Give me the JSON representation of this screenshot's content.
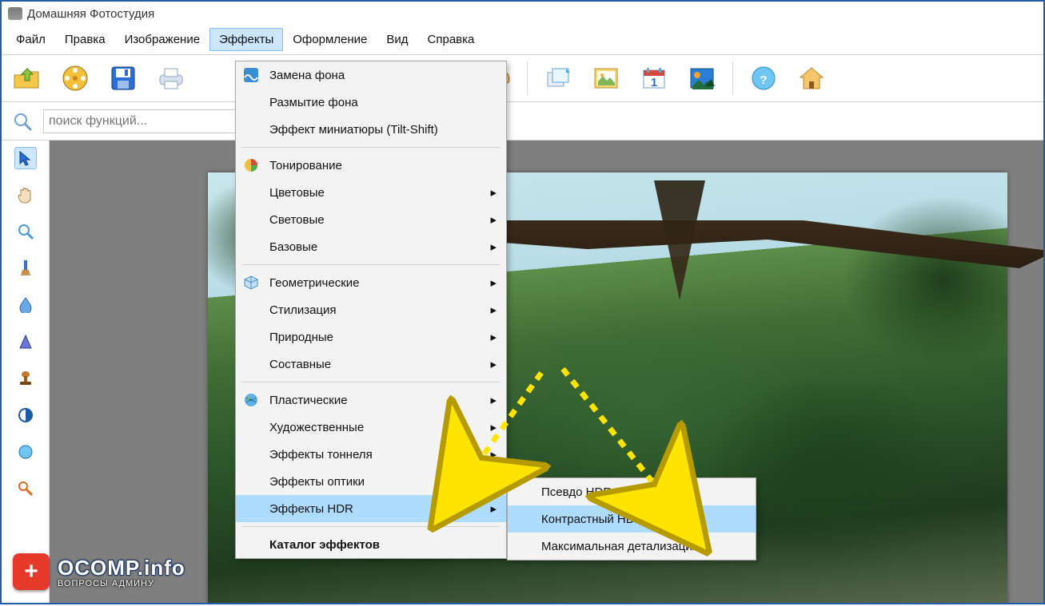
{
  "window": {
    "title": "Домашняя Фотостудия"
  },
  "menubar": {
    "items": [
      {
        "label": "Файл"
      },
      {
        "label": "Правка"
      },
      {
        "label": "Изображение"
      },
      {
        "label": "Эффекты",
        "active": true
      },
      {
        "label": "Оформление"
      },
      {
        "label": "Вид"
      },
      {
        "label": "Справка"
      }
    ]
  },
  "toolbar": {
    "buttons": [
      {
        "name": "open-folder-button",
        "icon": "folder-open"
      },
      {
        "name": "gallery-button",
        "icon": "reel"
      },
      {
        "name": "save-button",
        "icon": "floppy"
      },
      {
        "name": "print-button",
        "icon": "printer"
      },
      {
        "sep": true,
        "after_dropdown": true
      },
      {
        "name": "palette-button",
        "icon": "palette"
      },
      {
        "sep": true
      },
      {
        "name": "thumb-crop-button",
        "icon": "layer"
      },
      {
        "name": "frame-photo-button",
        "icon": "photo"
      },
      {
        "name": "calendar-button",
        "icon": "calendar"
      },
      {
        "name": "picture-button",
        "icon": "picture"
      },
      {
        "sep": true
      },
      {
        "name": "help-button",
        "icon": "help"
      },
      {
        "name": "home-button",
        "icon": "home"
      }
    ]
  },
  "search": {
    "placeholder": "поиск функций...",
    "value": ""
  },
  "sidetools": [
    {
      "name": "pointer-tool",
      "icon": "pointer",
      "active": true
    },
    {
      "name": "hand-tool",
      "icon": "hand"
    },
    {
      "name": "zoom-tool",
      "icon": "zoom"
    },
    {
      "name": "brush-tool",
      "icon": "brush"
    },
    {
      "name": "drop-tool",
      "icon": "drop"
    },
    {
      "name": "cone-tool",
      "icon": "cone"
    },
    {
      "name": "stamp-tool",
      "icon": "stamp"
    },
    {
      "name": "contrast-tool",
      "icon": "contrast"
    },
    {
      "name": "circle-tool",
      "icon": "circle"
    },
    {
      "name": "wand-tool",
      "icon": "wand"
    }
  ],
  "effects_menu": {
    "groups": [
      [
        {
          "label": "Замена фона",
          "icon": "wave"
        },
        {
          "label": "Размытие фона"
        },
        {
          "label": "Эффект миниатюры (Tilt-Shift)"
        }
      ],
      [
        {
          "label": "Тонирование",
          "icon": "colorball"
        },
        {
          "label": "Цветовые",
          "sub": true
        },
        {
          "label": "Световые",
          "sub": true
        },
        {
          "label": "Базовые",
          "sub": true
        }
      ],
      [
        {
          "label": "Геометрические",
          "icon": "cube",
          "sub": true
        },
        {
          "label": "Стилизация",
          "sub": true
        },
        {
          "label": "Природные",
          "sub": true
        },
        {
          "label": "Составные",
          "sub": true
        }
      ],
      [
        {
          "label": "Пластические",
          "icon": "globe",
          "sub": true
        },
        {
          "label": "Художественные",
          "sub": true
        },
        {
          "label": "Эффекты тоннеля",
          "sub": true
        },
        {
          "label": "Эффекты оптики",
          "sub": true
        },
        {
          "label": "Эффекты HDR",
          "sub": true,
          "highlight": true
        }
      ],
      [
        {
          "label": "Каталог эффектов",
          "bold": true
        }
      ]
    ]
  },
  "hdr_submenu": {
    "items": [
      {
        "label": "Псевдо HDR"
      },
      {
        "label": "Контрастный HDR",
        "highlight": true
      },
      {
        "label": "Максимальная детализация"
      }
    ]
  },
  "watermark": {
    "line1": "OCOMP.info",
    "line2": "ВОПРОСЫ АДМИНУ"
  }
}
